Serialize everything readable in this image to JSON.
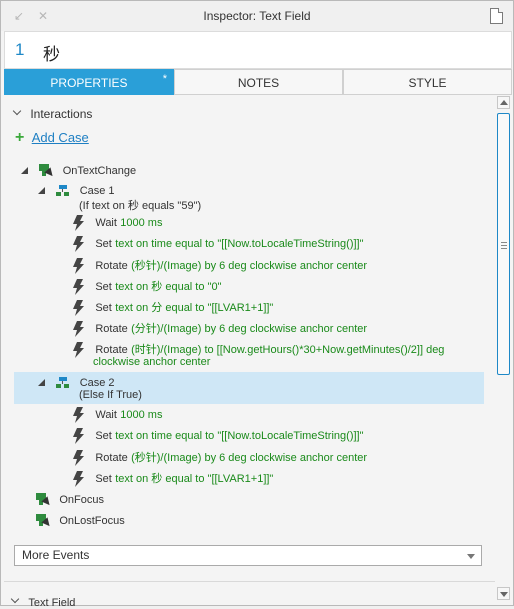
{
  "window": {
    "title": "Inspector: Text Field",
    "back_icon": "arrow-back-icon",
    "close_icon": "close-icon",
    "page_icon": "page-icon"
  },
  "widget": {
    "number": "1",
    "name": "秒"
  },
  "tabs": [
    {
      "label": "PROPERTIES",
      "active": true,
      "modified_marker": "*"
    },
    {
      "label": "NOTES",
      "active": false
    },
    {
      "label": "STYLE",
      "active": false
    }
  ],
  "interactions": {
    "section_label": "Interactions",
    "add_case_label": "Add Case",
    "events": [
      {
        "name": "OnTextChange",
        "cases": [
          {
            "title": "Case 1",
            "condition": "(If text on 秒 equals \"59\")",
            "actions": [
              {
                "verb": "Wait",
                "detail": "1000 ms"
              },
              {
                "verb": "Set",
                "detail": "text on time equal to \"[[Now.toLocaleTimeString()]]\""
              },
              {
                "verb": "Rotate",
                "detail": "(秒针)/(Image) by 6 deg clockwise anchor center"
              },
              {
                "verb": "Set",
                "detail": "text on 秒 equal to \"0\""
              },
              {
                "verb": "Set",
                "detail": "text on 分 equal to \"[[LVAR1+1]]\""
              },
              {
                "verb": "Rotate",
                "detail": "(分针)/(Image) by 6 deg clockwise anchor center"
              },
              {
                "verb": "Rotate",
                "detail": "(时针)/(Image) to [[Now.getHours()*30+Now.getMinutes()/2]] deg",
                "detail2": "clockwise anchor center"
              }
            ]
          },
          {
            "title": "Case 2",
            "condition": "(Else If True)",
            "selected": true,
            "actions": [
              {
                "verb": "Wait",
                "detail": "1000 ms"
              },
              {
                "verb": "Set",
                "detail": "text on time equal to \"[[Now.toLocaleTimeString()]]\""
              },
              {
                "verb": "Rotate",
                "detail": "(秒针)/(Image) by 6 deg clockwise anchor center"
              },
              {
                "verb": "Set",
                "detail": "text on 秒 equal to \"[[LVAR1+1]]\""
              }
            ]
          }
        ]
      },
      {
        "name": "OnFocus"
      },
      {
        "name": "OnLostFocus"
      }
    ],
    "more_events_label": "More Events"
  },
  "next_section_label": "Text Field",
  "colors": {
    "accent": "#2a9fd8",
    "action_text": "#1a8a1a",
    "link": "#1e7fc3",
    "selection": "#cfe7f6"
  }
}
